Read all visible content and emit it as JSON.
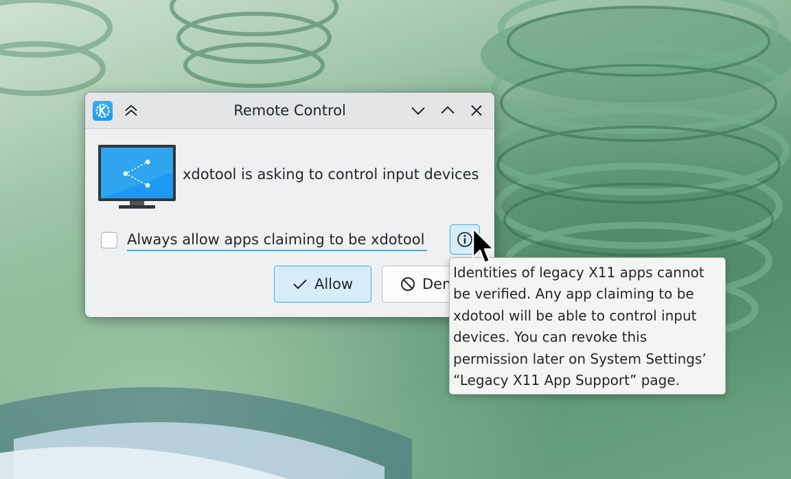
{
  "window": {
    "title": "Remote Control",
    "app_icon": "kde-logo-icon",
    "titlebar_buttons": [
      "keep-above-icon",
      "minimize-icon",
      "maximize-icon",
      "close-icon"
    ]
  },
  "dialog": {
    "icon": "remote-desktop-monitor-icon",
    "message": "xdotool is asking to control input devices",
    "checkbox": {
      "label": "Always allow apps claiming to be xdotool",
      "checked": false
    },
    "info_button_icon": "info-icon",
    "allow_button": {
      "label": "Allow",
      "icon": "checkmark-icon"
    },
    "deny_button": {
      "label": "Deny",
      "icon": "cancel-icon"
    }
  },
  "tooltip": {
    "lines": [
      "Identities of legacy X11 apps cannot",
      "be verified. Any app claiming to be",
      "xdotool will be able to control input",
      "devices. You can revoke this",
      "permission later on System Settings’",
      "“Legacy X11 App Support” page."
    ]
  },
  "colors": {
    "accent": "#3daee9",
    "accent_fill": "#d6ecf8",
    "window_bg": "#eff0f1",
    "text": "#232629"
  }
}
